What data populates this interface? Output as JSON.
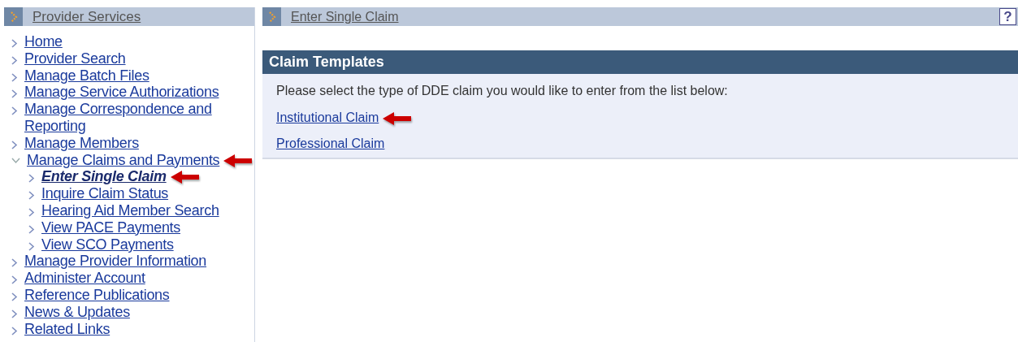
{
  "sidebar": {
    "title": "Provider Services",
    "items": [
      {
        "label": "Home",
        "selected": false,
        "expanded": false,
        "annotated": false
      },
      {
        "label": "Provider Search",
        "selected": false,
        "expanded": false,
        "annotated": false
      },
      {
        "label": "Manage Batch Files",
        "selected": false,
        "expanded": false,
        "annotated": false
      },
      {
        "label": "Manage Service Authorizations",
        "selected": false,
        "expanded": false,
        "annotated": false
      },
      {
        "label": "Manage Correspondence and Reporting",
        "selected": false,
        "expanded": false,
        "annotated": false
      },
      {
        "label": "Manage Members",
        "selected": false,
        "expanded": false,
        "annotated": false
      },
      {
        "label": "Manage Claims and Payments",
        "selected": false,
        "expanded": true,
        "annotated": true,
        "children": [
          {
            "label": "Enter Single Claim",
            "selected": true,
            "annotated": true
          },
          {
            "label": "Inquire Claim Status",
            "selected": false,
            "annotated": false
          },
          {
            "label": "Hearing Aid Member Search",
            "selected": false,
            "annotated": false
          },
          {
            "label": "View PACE Payments",
            "selected": false,
            "annotated": false
          },
          {
            "label": "View SCO Payments",
            "selected": false,
            "annotated": false
          }
        ]
      },
      {
        "label": "Manage Provider Information",
        "selected": false,
        "expanded": false,
        "annotated": false
      },
      {
        "label": "Administer Account",
        "selected": false,
        "expanded": false,
        "annotated": false
      },
      {
        "label": "Reference Publications",
        "selected": false,
        "expanded": false,
        "annotated": false
      },
      {
        "label": "News & Updates",
        "selected": false,
        "expanded": false,
        "annotated": false
      },
      {
        "label": "Related Links",
        "selected": false,
        "expanded": false,
        "annotated": false
      }
    ]
  },
  "main": {
    "breadcrumb": "Enter Single Claim",
    "help": "?",
    "section": {
      "title": "Claim Templates",
      "instruction": "Please select the type of DDE claim you would like to enter from the list below:",
      "links": [
        {
          "label": "Institutional Claim",
          "annotated": true
        },
        {
          "label": "Professional Claim",
          "annotated": false
        }
      ]
    }
  }
}
